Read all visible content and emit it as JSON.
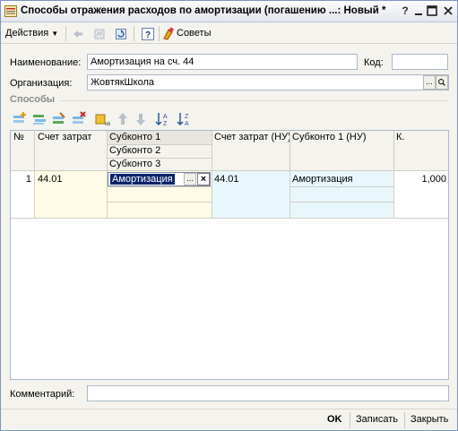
{
  "window": {
    "title": "Способы отражения расходов по амортизации (погашению ...: Новый *",
    "help_label": "?",
    "title_color": "#000000"
  },
  "toolbar": {
    "actions_label": "Действия",
    "sovety_label": "Советы",
    "icons": [
      "form-icon",
      "arrow-left-icon",
      "record-icon",
      "refresh-icon",
      "help-icon",
      "tips-icon"
    ]
  },
  "form": {
    "name_label": "Наименование:",
    "name_value": "Амортизация на сч. 44",
    "code_label": "Код:",
    "code_value": "",
    "org_label": "Организация:",
    "org_value": "ЖовтякШкола",
    "group_title": "Способы",
    "comment_label": "Комментарий:",
    "comment_value": "",
    "ellipsis": "...",
    "clear_symbol": "×"
  },
  "table": {
    "headers": {
      "num": "№",
      "account": "Счет затрат",
      "subkonto1": "Субконто 1",
      "subkonto2": "Субконто 2",
      "subkonto3": "Субконто 3",
      "account_nu": "Счет затрат (НУ)",
      "subkonto1_nu": "Субконто 1 (НУ)",
      "k": "К."
    },
    "rows": [
      {
        "num": "1",
        "account": "44.01",
        "subkonto1": "Амортизация",
        "subkonto2": "",
        "subkonto3": "",
        "account_nu": "44.01",
        "subkonto1_nu": "Амортизация",
        "k": "1,000"
      }
    ]
  },
  "footer": {
    "ok_label": "OK",
    "save_label": "Записать",
    "close_label": "Закрыть"
  },
  "colors": {
    "accent": "#0a246a",
    "header_bg": "#f4f3ee",
    "yellow_cell": "#fffbe6",
    "blue_cell": "#e8f7fc"
  }
}
